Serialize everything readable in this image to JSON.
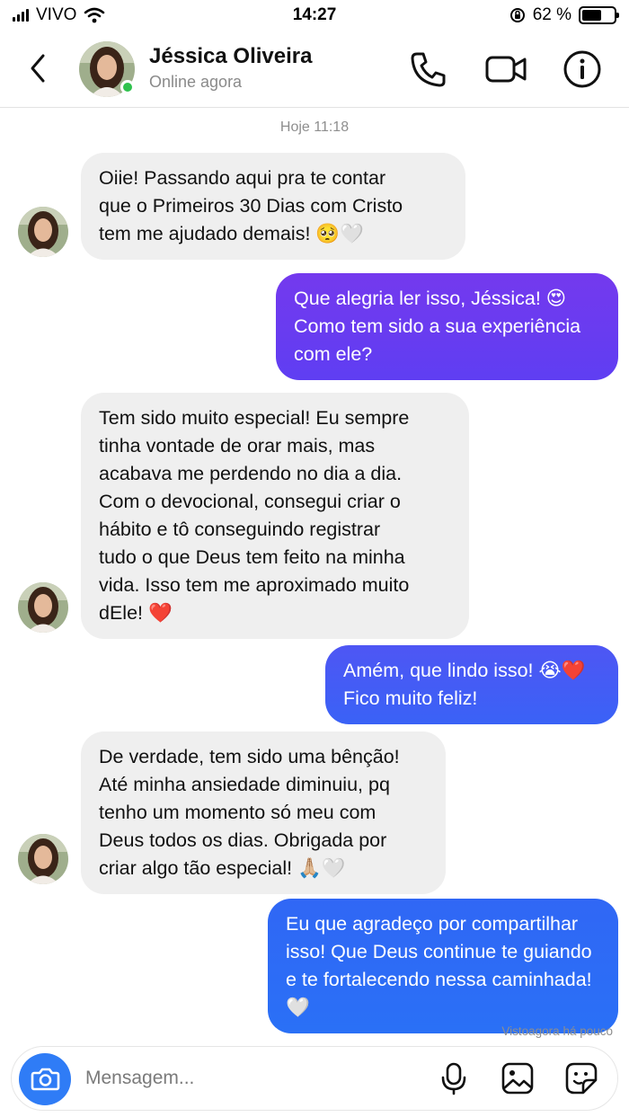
{
  "status_bar": {
    "carrier": "VIVO",
    "time": "14:27",
    "battery_text": "62 %",
    "battery_level": 0.62
  },
  "header": {
    "contact_name": "Jéssica Oliveira",
    "contact_status": "Online agora",
    "icons": [
      "back-chevron-icon",
      "phone-icon",
      "video-camera-icon",
      "info-icon"
    ]
  },
  "chat": {
    "date_label": "Hoje 11:18",
    "messages": [
      {
        "direction": "in",
        "lines": [
          "Oiie! Passando aqui pra te contar",
          "que o Primeiros 30 Dias com Cristo",
          "tem me ajudado demais! 🥺🤍"
        ]
      },
      {
        "direction": "out",
        "lines": [
          "Que alegria ler isso, Jéssica! 😍",
          "Como tem sido a sua experiência",
          "com ele?"
        ]
      },
      {
        "direction": "in",
        "lines": [
          "Tem sido muito especial! Eu sempre",
          "tinha vontade de orar mais, mas",
          "acabava me perdendo no dia a dia.",
          "Com o devocional, consegui criar o",
          "hábito e tô conseguindo registrar",
          "tudo o que Deus tem feito na minha",
          "vida. Isso tem me aproximado muito",
          "dEle! ❤️"
        ]
      },
      {
        "direction": "out",
        "lines": [
          "Amém, que lindo isso! 😭❤️",
          "Fico muito feliz!"
        ]
      },
      {
        "direction": "in",
        "lines": [
          "De verdade, tem sido uma bênção!",
          "Até minha ansiedade diminuiu, pq",
          "tenho um momento só meu com",
          "Deus todos os dias. Obrigada por",
          "criar algo tão especial! 🙏🏼🤍"
        ]
      },
      {
        "direction": "out",
        "lines": [
          "Eu que agradeço por compartilhar",
          "isso! Que Deus continue te guiando",
          "e te fortalecendo nessa caminhada!",
          "🤍"
        ]
      }
    ],
    "seen_text": "Vistoagora há pouco"
  },
  "composer": {
    "placeholder": "Mensagem...",
    "icons": [
      "camera-icon",
      "microphone-icon",
      "gallery-icon",
      "sticker-icon"
    ]
  },
  "colors": {
    "bubble_in": "#efefef",
    "bubble_out_purple": "#6a3cf0",
    "bubble_out_blue": "#2d6df6",
    "accent_blue": "#2f7cf6",
    "online_green": "#2fc24d"
  }
}
